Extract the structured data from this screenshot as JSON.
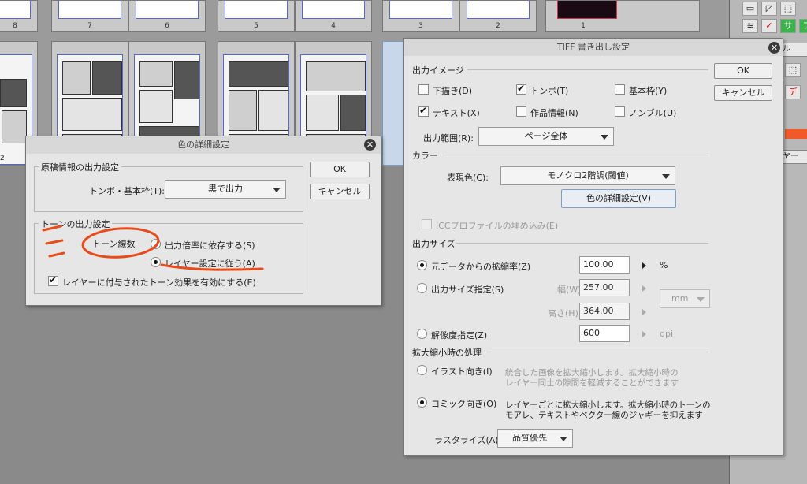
{
  "pages_top": [
    "8",
    "7",
    "6",
    "5",
    "4",
    "3",
    "2",
    "1"
  ],
  "pages_bottom_left_num": "2",
  "color_dialog": {
    "title": "色の詳細設定",
    "group1_title": "原稿情報の出力設定",
    "tombo_label": "トンボ・基本枠(T):",
    "tombo_value": "黒で出力",
    "group2_title": "トーンの出力設定",
    "annotation": "トーン線数",
    "radio1": "出力倍率に依存する(S)",
    "radio2": "レイヤー設定に従う(A)",
    "checkbox": "レイヤーに付与されたトーン効果を有効にする(E)",
    "ok": "OK",
    "cancel": "キャンセル",
    "annotation_color": "#e84a1a"
  },
  "tiff_dialog": {
    "title": "TIFF 書き出し設定",
    "ok": "OK",
    "cancel": "キャンセル",
    "output_image": {
      "title": "出力イメージ",
      "draft": "下描き(D)",
      "tombo": "トンボ(T)",
      "frame": "基本枠(Y)",
      "text": "テキスト(X)",
      "work_info": "作品情報(N)",
      "nombre": "ノンブル(U)",
      "range_label": "出力範囲(R):",
      "range_value": "ページ全体"
    },
    "color": {
      "title": "カラー",
      "expr_label": "表現色(C):",
      "expr_value": "モノクロ2階調(閾値)",
      "detail_button": "色の詳細設定(V)",
      "icc": "ICCプロファイルの埋め込み(E)"
    },
    "output_size": {
      "title": "出力サイズ",
      "scale_label": "元データからの拡縮率(Z)",
      "scale_value": "100.00",
      "scale_unit": "%",
      "size_label": "出力サイズ指定(S)",
      "width_label": "幅(W):",
      "width_value": "257.00",
      "height_label": "高さ(H):",
      "height_value": "364.00",
      "unit_value": "mm",
      "res_label": "解像度指定(Z)",
      "res_value": "600",
      "res_unit": "dpi"
    },
    "scaling": {
      "title": "拡大縮小時の処理",
      "illust_label": "イラスト向き(I)",
      "illust_desc1": "統合した画像を拡大縮小します。拡大縮小時の",
      "illust_desc2": "レイヤー同士の隙間を軽減することができます",
      "comic_label": "コミック向き(O)",
      "comic_desc1": "レイヤーごとに拡大縮小します。拡大縮小時のトーンの",
      "comic_desc2": "モアレ、テキストやベクター線のジャギーを抑えます",
      "raster_label": "ラスタライズ(A):",
      "raster_value": "品質優先"
    }
  },
  "right_panel": {
    "tab1": "ル",
    "tab2": "ヤー"
  }
}
